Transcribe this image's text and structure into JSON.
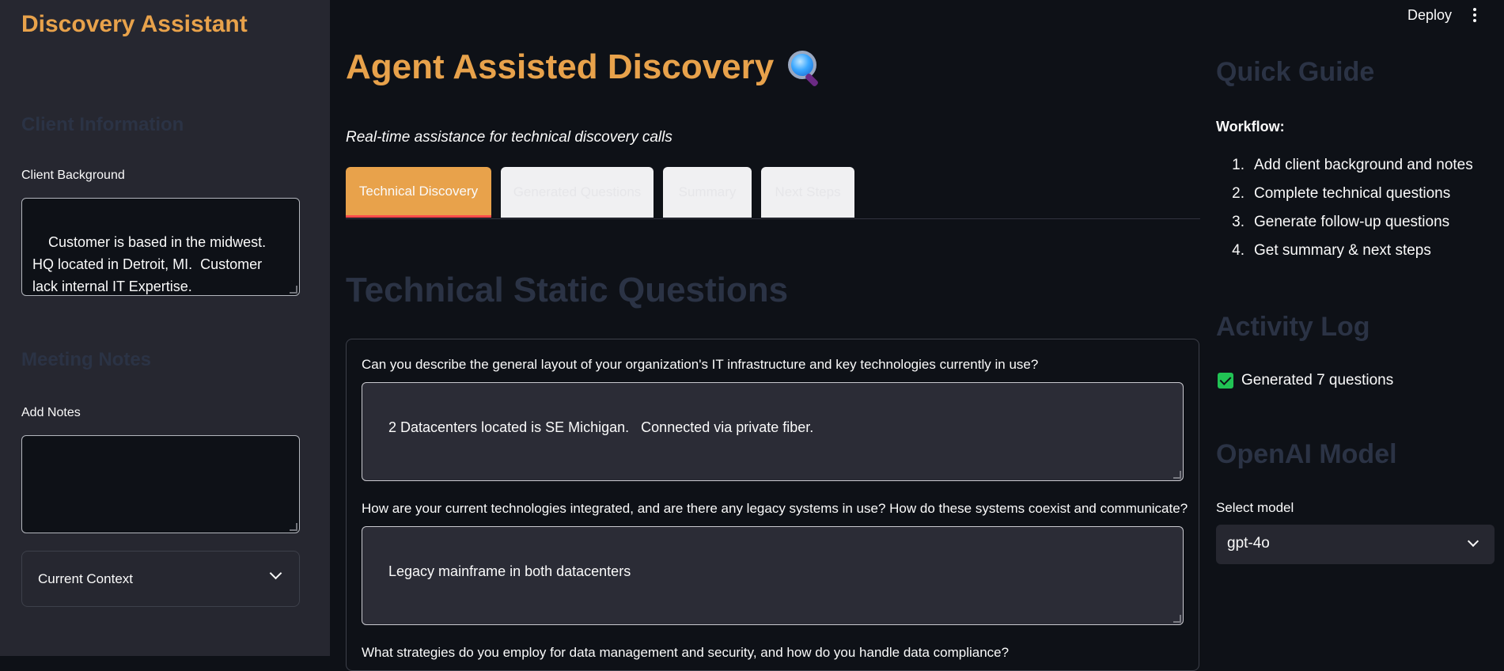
{
  "sidebar": {
    "app_title": "Discovery Assistant",
    "client_info_heading": "Client Information",
    "client_background_label": "Client Background",
    "client_background_value": "Customer is based in the midwest.  HQ located in Detroit, MI.  Customer lack internal IT Expertise.",
    "meeting_notes_heading": "Meeting Notes",
    "add_notes_label": "Add Notes",
    "add_notes_value": "",
    "current_context_label": "Current Context"
  },
  "topbar": {
    "deploy_label": "Deploy"
  },
  "main": {
    "title": "Agent Assisted Discovery",
    "subtitle": "Real-time assistance for technical discovery calls",
    "tabs": [
      {
        "label": "Technical Discovery",
        "active": true
      },
      {
        "label": "Generated Questions",
        "active": false
      },
      {
        "label": "Summary",
        "active": false
      },
      {
        "label": "Next Steps",
        "active": false
      }
    ],
    "section_heading": "Technical Static Questions",
    "questions": [
      {
        "question": "Can you describe the general layout of your organization's IT infrastructure and key technologies currently in use?",
        "answer": "2 Datacenters located is SE Michigan.   Connected via private fiber."
      },
      {
        "question": "How are your current technologies integrated, and are there any legacy systems in use? How do these systems coexist and communicate?",
        "answer": "Legacy mainframe in both datacenters"
      },
      {
        "question": "What strategies do you employ for data management and security, and how do you handle data compliance?",
        "answer": ""
      }
    ]
  },
  "right_panel": {
    "quick_guide_heading": "Quick Guide",
    "workflow_label": "Workflow:",
    "workflow_steps": [
      {
        "num": "1.",
        "text": "Add client background and notes"
      },
      {
        "num": "2.",
        "text": "Complete technical questions"
      },
      {
        "num": "3.",
        "text": "Generate follow-up questions"
      },
      {
        "num": "4.",
        "text": "Get summary & next steps"
      }
    ],
    "activity_log_heading": "Activity Log",
    "activity_items": [
      {
        "text": "Generated 7 questions",
        "status": "checked"
      }
    ],
    "model_heading": "OpenAI Model",
    "select_model_label": "Select model",
    "selected_model": "gpt-4o"
  },
  "colors": {
    "accent": "#e8a24b",
    "background": "#0e1117",
    "sidebar": "#262730",
    "active_tab_underline": "#ff4b4b",
    "check": "#21c354"
  }
}
